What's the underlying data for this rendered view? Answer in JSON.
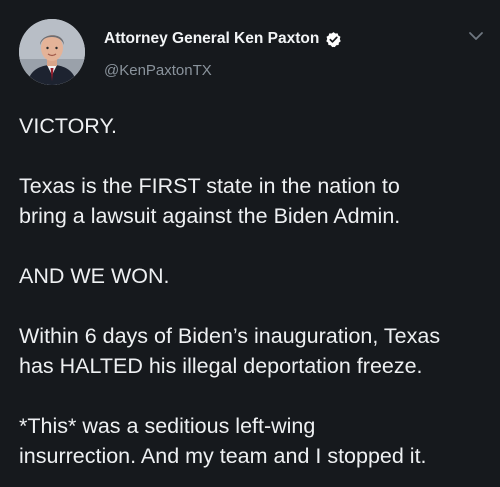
{
  "author": {
    "display_name": "Attorney General Ken Paxton",
    "handle": "@KenPaxtonTX",
    "verified": true,
    "avatar_icon": "profile-photo"
  },
  "icons": {
    "verified": "verified-badge-icon",
    "more": "chevron-down-icon"
  },
  "colors": {
    "background": "#16191d",
    "text": "#eef0f2",
    "secondary_text": "#8a939c"
  },
  "tweet": {
    "lines": [
      "VICTORY.",
      "Texas is the FIRST state in the nation to",
      "bring a lawsuit against the Biden Admin.",
      "AND WE WON.",
      "Within 6 days of Biden’s inauguration, Texas",
      "has HALTED his illegal deportation freeze.",
      "*This* was a seditious left-wing",
      "insurrection. And my team and I stopped it."
    ]
  }
}
